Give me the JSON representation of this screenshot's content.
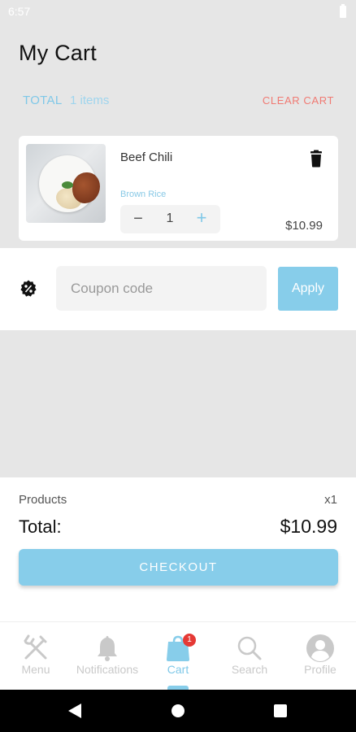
{
  "status_bar": {
    "time": "6:57"
  },
  "header": {
    "title": "My Cart"
  },
  "summary": {
    "total_label": "TOTAL",
    "items_count": "1 items",
    "clear_cart_label": "CLEAR CART"
  },
  "cart_items": [
    {
      "name": "Beef Chili",
      "option": "Brown Rice",
      "quantity": "1",
      "price": "$10.99",
      "minus": "−",
      "plus": "+"
    }
  ],
  "coupon": {
    "placeholder": "Coupon code",
    "value": "",
    "apply_label": "Apply"
  },
  "checkout": {
    "products_label": "Products",
    "products_qty": "x1",
    "total_label": "Total:",
    "total_amount": "$10.99",
    "button_label": "CHECKOUT"
  },
  "bottom_nav": {
    "items": [
      {
        "label": "Menu",
        "icon": "fork-knife-icon"
      },
      {
        "label": "Notifications",
        "icon": "bell-icon"
      },
      {
        "label": "Cart",
        "icon": "shopping-bag-icon",
        "badge": "1",
        "active": true
      },
      {
        "label": "Search",
        "icon": "search-icon"
      },
      {
        "label": "Profile",
        "icon": "user-icon"
      }
    ]
  },
  "colors": {
    "accent": "#87cdea",
    "danger": "#f07a73",
    "badge": "#e53935",
    "background": "#e6e6e6"
  }
}
